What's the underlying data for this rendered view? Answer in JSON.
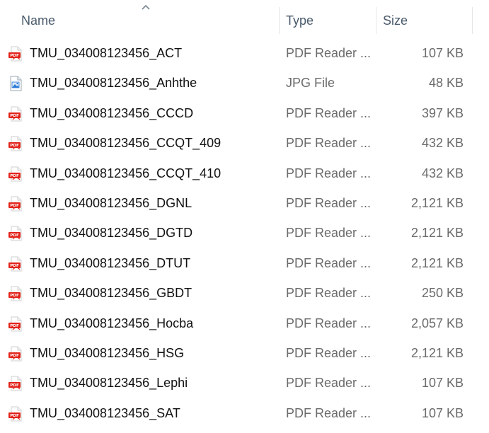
{
  "columns": {
    "name": "Name",
    "type": "Type",
    "size": "Size"
  },
  "sort": {
    "column": "name",
    "direction": "ascending"
  },
  "colors": {
    "pdf_icon": "#e2231a",
    "jpg_icon": "#2b7bd6",
    "header_text": "#4a5a6b",
    "secondary_text": "#6b6b6b"
  },
  "files": [
    {
      "name": "TMU_034008123456_ACT",
      "type": "PDF Reader ...",
      "size": "107 KB",
      "icon": "pdf-file-icon"
    },
    {
      "name": "TMU_034008123456_Anhthe",
      "type": "JPG File",
      "size": "48 KB",
      "icon": "jpg-file-icon"
    },
    {
      "name": "TMU_034008123456_CCCD",
      "type": "PDF Reader ...",
      "size": "397 KB",
      "icon": "pdf-file-icon"
    },
    {
      "name": "TMU_034008123456_CCQT_409",
      "type": "PDF Reader ...",
      "size": "432 KB",
      "icon": "pdf-file-icon"
    },
    {
      "name": "TMU_034008123456_CCQT_410",
      "type": "PDF Reader ...",
      "size": "432 KB",
      "icon": "pdf-file-icon"
    },
    {
      "name": "TMU_034008123456_DGNL",
      "type": "PDF Reader ...",
      "size": "2,121 KB",
      "icon": "pdf-file-icon"
    },
    {
      "name": "TMU_034008123456_DGTD",
      "type": "PDF Reader ...",
      "size": "2,121 KB",
      "icon": "pdf-file-icon"
    },
    {
      "name": "TMU_034008123456_DTUT",
      "type": "PDF Reader ...",
      "size": "2,121 KB",
      "icon": "pdf-file-icon"
    },
    {
      "name": "TMU_034008123456_GBDT",
      "type": "PDF Reader ...",
      "size": "250 KB",
      "icon": "pdf-file-icon"
    },
    {
      "name": "TMU_034008123456_Hocba",
      "type": "PDF Reader ...",
      "size": "2,057 KB",
      "icon": "pdf-file-icon"
    },
    {
      "name": "TMU_034008123456_HSG",
      "type": "PDF Reader ...",
      "size": "2,121 KB",
      "icon": "pdf-file-icon"
    },
    {
      "name": "TMU_034008123456_Lephi",
      "type": "PDF Reader ...",
      "size": "107 KB",
      "icon": "pdf-file-icon"
    },
    {
      "name": "TMU_034008123456_SAT",
      "type": "PDF Reader ...",
      "size": "107 KB",
      "icon": "pdf-file-icon"
    }
  ]
}
